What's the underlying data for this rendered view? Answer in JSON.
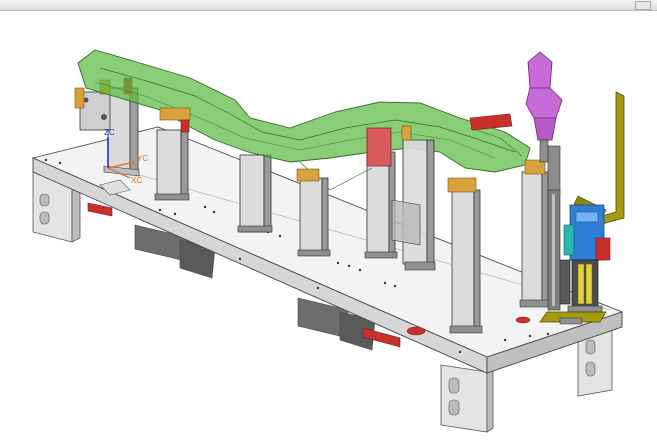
{
  "viewport": {
    "background": "#ffffff",
    "wcs_labels": {
      "zc": "ZC",
      "yc": "YC",
      "xc": "XC"
    }
  },
  "model": {
    "components": [
      "base-plate",
      "support-legs",
      "risers",
      "datum-blocks",
      "workpiece-frame",
      "rear-clamp-post",
      "cylinder-assembly",
      "swing-arm",
      "end-locator",
      "slide-rail",
      "red-pads"
    ]
  },
  "colors": {
    "workpiece_green": "#4fb13a",
    "clamp_orange": "#d8a23c",
    "pad_red": "#c9302c",
    "tool_magenta": "#c56ad6",
    "arm_olive": "#a59a10",
    "steel_light": "#e7e7e7",
    "steel_dark": "#9a9a9a",
    "axis_z": "#1f2fd0",
    "axis_label": "#e06a1a"
  }
}
